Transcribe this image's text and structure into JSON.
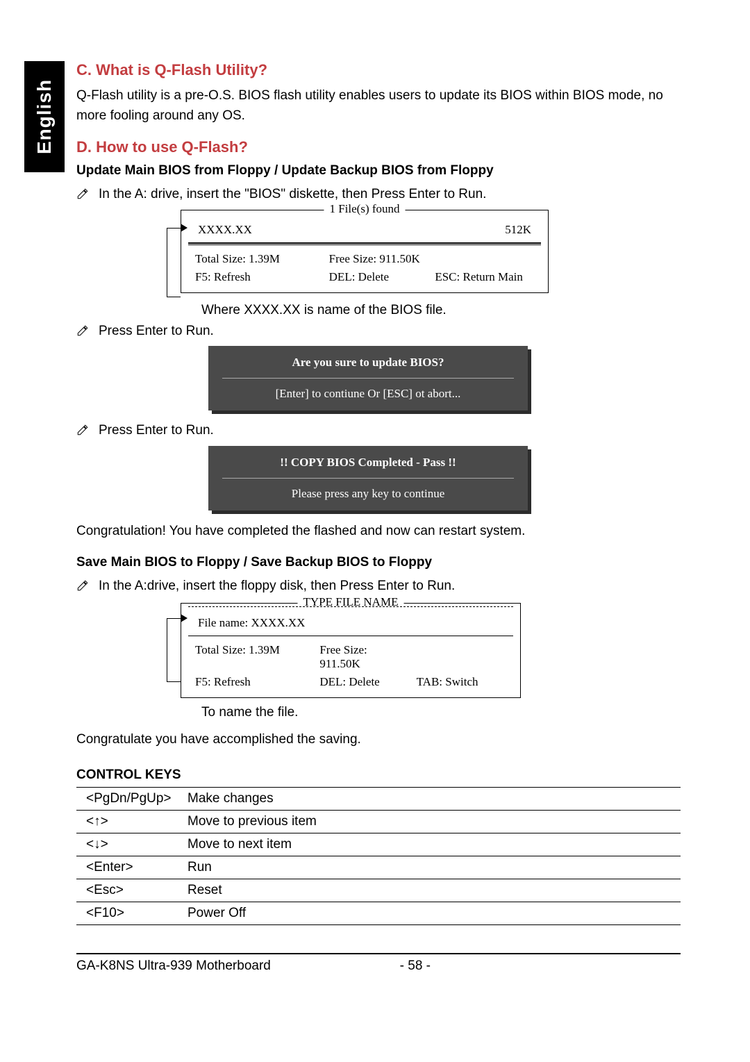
{
  "sidebar": {
    "lang": "English"
  },
  "sectionC": {
    "title": "C. What is Q-Flash Utility?",
    "body": "Q-Flash utility is a pre-O.S. BIOS flash utility enables users to update its BIOS within BIOS mode, no more fooling around any OS."
  },
  "sectionD": {
    "title": "D.  How to use Q-Flash?",
    "subtitle1": "Update Main BIOS from Floppy / Update Backup BIOS from Floppy",
    "step1": "In the A: drive, insert the \"BIOS\" diskette, then Press Enter to Run.",
    "box1": {
      "title": "1 File(s) found",
      "filename": "XXXX.XX",
      "filesize": "512K",
      "total": "Total Size: 1.39M",
      "free": "Free Size: 911.50K",
      "f5": "F5: Refresh",
      "del": "DEL: Delete",
      "esc": "ESC: Return Main"
    },
    "caption1": "Where XXXX.XX is name of the BIOS file.",
    "step2": "Press Enter to Run.",
    "box2": {
      "line1": "Are you sure to update BIOS?",
      "line2": "[Enter] to contiune Or [ESC] ot abort..."
    },
    "step3": "Press Enter to Run.",
    "box3": {
      "line1": "!! COPY BIOS Completed - Pass !!",
      "line2": "Please press any key to continue"
    },
    "congrat1": "Congratulation! You have completed the flashed and now can restart system.",
    "subtitle2": "Save Main BIOS to Floppy / Save Backup BIOS to Floppy",
    "step4": "In the A:drive, insert the floppy disk, then Press Enter to Run.",
    "box4": {
      "title": "TYPE FILE NAME",
      "filename_label": "File name: XXXX.XX",
      "total": "Total Size: 1.39M",
      "free": "Free Size: 911.50K",
      "f5": "F5: Refresh",
      "del": "DEL: Delete",
      "tab": "TAB: Switch"
    },
    "caption2": "To name the file.",
    "congrat2": "Congratulate you have accomplished the saving."
  },
  "controlKeys": {
    "title": "CONTROL KEYS",
    "rows": [
      {
        "key": "<PgDn/PgUp>",
        "desc": "Make changes"
      },
      {
        "key": "<↑>",
        "desc": "Move to previous item"
      },
      {
        "key": "<↓>",
        "desc": "Move to next item"
      },
      {
        "key": "<Enter>",
        "desc": "Run"
      },
      {
        "key": "<Esc>",
        "desc": "Reset"
      },
      {
        "key": "<F10>",
        "desc": "Power Off"
      }
    ]
  },
  "footer": {
    "model": "GA-K8NS Ultra-939 Motherboard",
    "page": "- 58 -"
  }
}
